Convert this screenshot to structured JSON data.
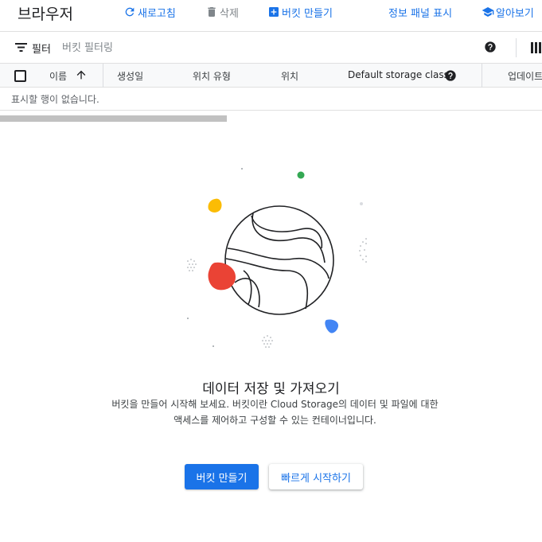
{
  "header": {
    "title": "브라우저",
    "refresh_label": "새로고침",
    "delete_label": "삭제",
    "create_bucket_label": "버킷 만들기",
    "show_info_panel_label": "정보 패널 표시",
    "learn_label": "알아보기"
  },
  "filter": {
    "label": "필터",
    "placeholder": "버킷 필터링"
  },
  "table": {
    "columns": [
      "이름",
      "생성일",
      "위치 유형",
      "위치",
      "Default storage class",
      "업데이트"
    ],
    "sort_column": "이름",
    "sort_direction": "ascending",
    "empty_message": "표시할 행이 없습니다."
  },
  "empty_state": {
    "title": "데이터 저장 및 가져오기",
    "description_line1": "버킷을 만들어 시작해 보세요. 버킷이란 Cloud Storage의 데이터 및 파일에 대한",
    "description_line2": "액세스를 제어하고 구성할 수 있는 컨테이너입니다.",
    "primary_button": "버킷 만들기",
    "secondary_button": "빠르게 시작하기"
  },
  "colors": {
    "accent": "#1a73e8",
    "red": "#ea4335",
    "yellow": "#fbbc04",
    "green": "#34a853",
    "blue": "#4285f4"
  }
}
